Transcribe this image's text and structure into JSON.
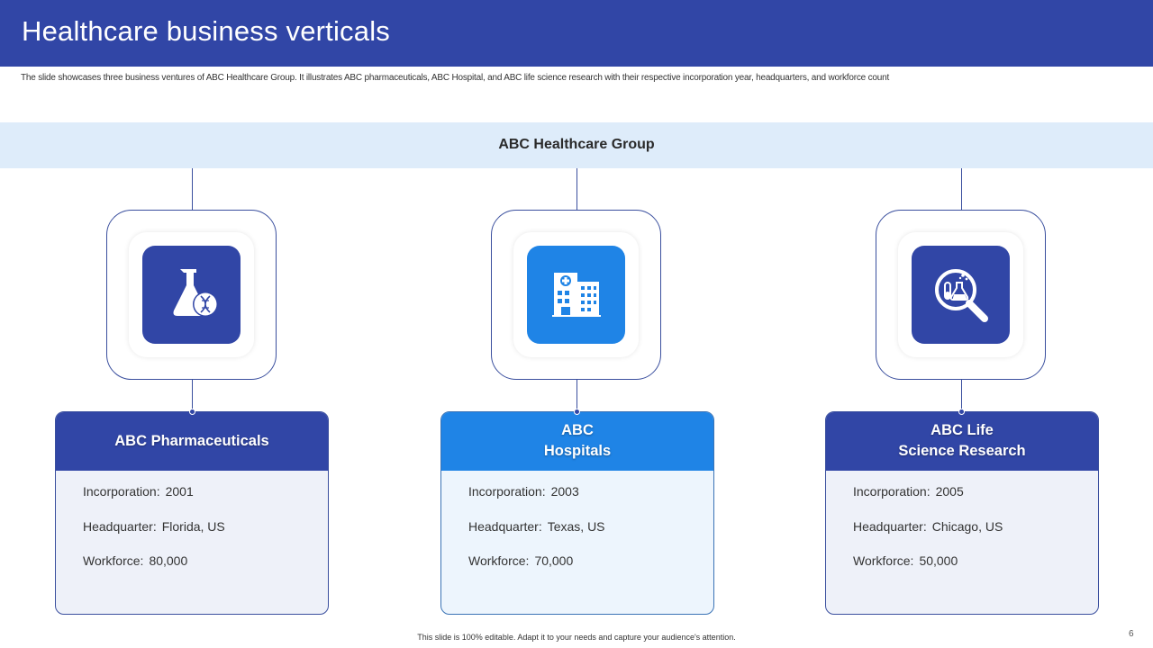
{
  "header": {
    "title": "Healthcare business verticals",
    "subtitle": "The slide showcases three business ventures of ABC Healthcare Group. It illustrates ABC pharmaceuticals, ABC Hospital, and ABC life science research with their respective incorporation year, headquarters, and workforce count"
  },
  "group": {
    "label": "ABC Healthcare Group"
  },
  "colors": {
    "brand_dark": "#3146a6",
    "brand_light": "#1f84e6",
    "band": "#deecfa"
  },
  "verticals": [
    {
      "icon": "flask-dna-icon",
      "title": "ABC Pharmaceuticals",
      "incorporation_label": "Incorporation:",
      "incorporation": "2001",
      "headquarter_label": "Headquarter:",
      "headquarter": "Florida, US",
      "workforce_label": "Workforce:",
      "workforce": "80,000"
    },
    {
      "icon": "hospital-building-icon",
      "title": "ABC\nHospitals",
      "incorporation_label": "Incorporation:",
      "incorporation": "2003",
      "headquarter_label": "Headquarter:",
      "headquarter": "Texas, US",
      "workforce_label": "Workforce:",
      "workforce": "70,000"
    },
    {
      "icon": "lab-magnifier-icon",
      "title": "ABC Life\nScience Research",
      "incorporation_label": "Incorporation:",
      "incorporation": "2005",
      "headquarter_label": "Headquarter:",
      "headquarter": "Chicago, US",
      "workforce_label": "Workforce:",
      "workforce": "50,000"
    }
  ],
  "footer": {
    "note": "This slide is 100% editable. Adapt it to your needs and capture your audience's attention.",
    "page": "6"
  }
}
